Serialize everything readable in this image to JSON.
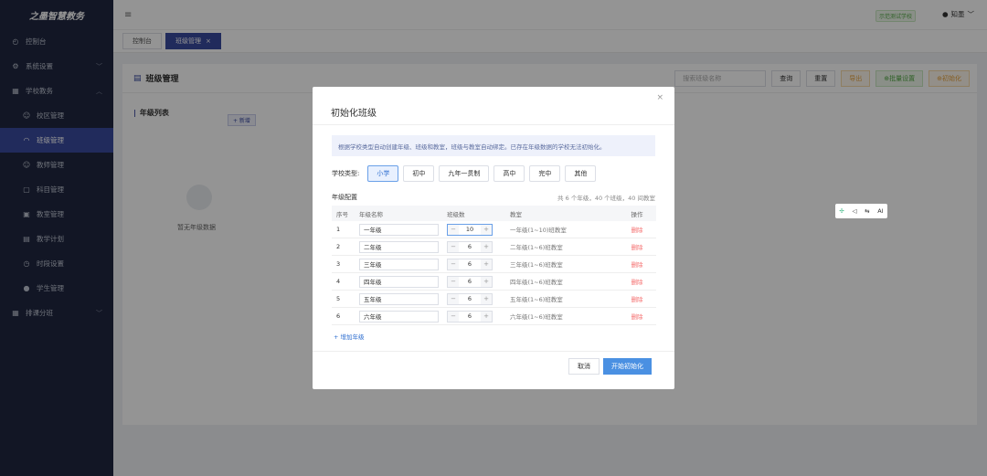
{
  "brand": "之墨智慧教务",
  "sidebar": {
    "items": [
      {
        "label": "控制台",
        "icon": "dashboard-icon",
        "glyph": "◴"
      },
      {
        "label": "系统设置",
        "icon": "gear-icon",
        "glyph": "⚙",
        "chev": "﹀"
      },
      {
        "label": "学校教务",
        "icon": "building-icon",
        "glyph": "▦",
        "chev": "︿"
      },
      {
        "label": "校区管理",
        "icon": "user-icon",
        "glyph": "☺",
        "sub": true
      },
      {
        "label": "班级管理",
        "icon": "bell-icon",
        "glyph": "◠",
        "sub": true,
        "active": true
      },
      {
        "label": "教师管理",
        "icon": "user-icon",
        "glyph": "☺",
        "sub": true
      },
      {
        "label": "科目管理",
        "icon": "book-icon",
        "glyph": "▢",
        "sub": true
      },
      {
        "label": "教室管理",
        "icon": "room-icon",
        "glyph": "▣",
        "sub": true
      },
      {
        "label": "教学计划",
        "icon": "doc-icon",
        "glyph": "▤",
        "sub": true
      },
      {
        "label": "时段设置",
        "icon": "clock-icon",
        "glyph": "◷",
        "sub": true
      },
      {
        "label": "学生管理",
        "icon": "student-icon",
        "glyph": "●",
        "sub": true
      },
      {
        "label": "排课分班",
        "icon": "calendar-icon",
        "glyph": "▦",
        "chev": "﹀"
      }
    ]
  },
  "header": {
    "menu_glyph": "≡",
    "school_badge": "示范测试学校",
    "user_name": "知墨",
    "user_glyph": "●",
    "user_chev": "﹀"
  },
  "tabs": [
    {
      "label": "控制台",
      "active": false
    },
    {
      "label": "班级管理",
      "active": true,
      "close": "×"
    }
  ],
  "page": {
    "title_glyph": "▤",
    "title": "班级管理",
    "search_placeholder": "搜索班级名称",
    "query": "查询",
    "reset": "重置",
    "export": "导出",
    "batch": "⊕批量设置",
    "init": "⊕初始化",
    "grade_list": "年级列表",
    "add": "+ 新增",
    "empty": "暂无年级数据"
  },
  "dialog": {
    "title": "初始化班级",
    "close": "×",
    "notice": "根据学校类型自动创建年级、班级和教室，班级与教室自动绑定。已存在年级数据的学校无法初始化。",
    "type_label": "学校类型:",
    "types": [
      {
        "label": "小学",
        "active": true
      },
      {
        "label": "初中",
        "active": false
      },
      {
        "label": "九年一贯制",
        "active": false
      },
      {
        "label": "高中",
        "active": false
      },
      {
        "label": "完中",
        "active": false
      },
      {
        "label": "其他",
        "active": false
      }
    ],
    "config_label": "年级配置",
    "summary": "共 6 个年级，40 个班级，40 间教室",
    "columns": [
      "序号",
      "年级名称",
      "班级数",
      "教室",
      "操作"
    ],
    "rows": [
      {
        "no": "1",
        "name": "一年级",
        "count": "10",
        "room": "一年级(1~10)班教室",
        "action": "删除",
        "focus": true
      },
      {
        "no": "2",
        "name": "二年级",
        "count": "6",
        "room": "二年级(1~6)班教室",
        "action": "删除"
      },
      {
        "no": "3",
        "name": "三年级",
        "count": "6",
        "room": "三年级(1~6)班教室",
        "action": "删除"
      },
      {
        "no": "4",
        "name": "四年级",
        "count": "6",
        "room": "四年级(1~6)班教室",
        "action": "删除"
      },
      {
        "no": "5",
        "name": "五年级",
        "count": "6",
        "room": "五年级(1~6)班教室",
        "action": "删除"
      },
      {
        "no": "6",
        "name": "六年级",
        "count": "6",
        "room": "六年级(1~6)班教室",
        "action": "删除"
      }
    ],
    "add_grade": "+ 增加年级",
    "cancel": "取消",
    "confirm": "开始初始化"
  },
  "floating": {
    "items": [
      "✢",
      "◁",
      "⇆",
      "AI"
    ]
  }
}
